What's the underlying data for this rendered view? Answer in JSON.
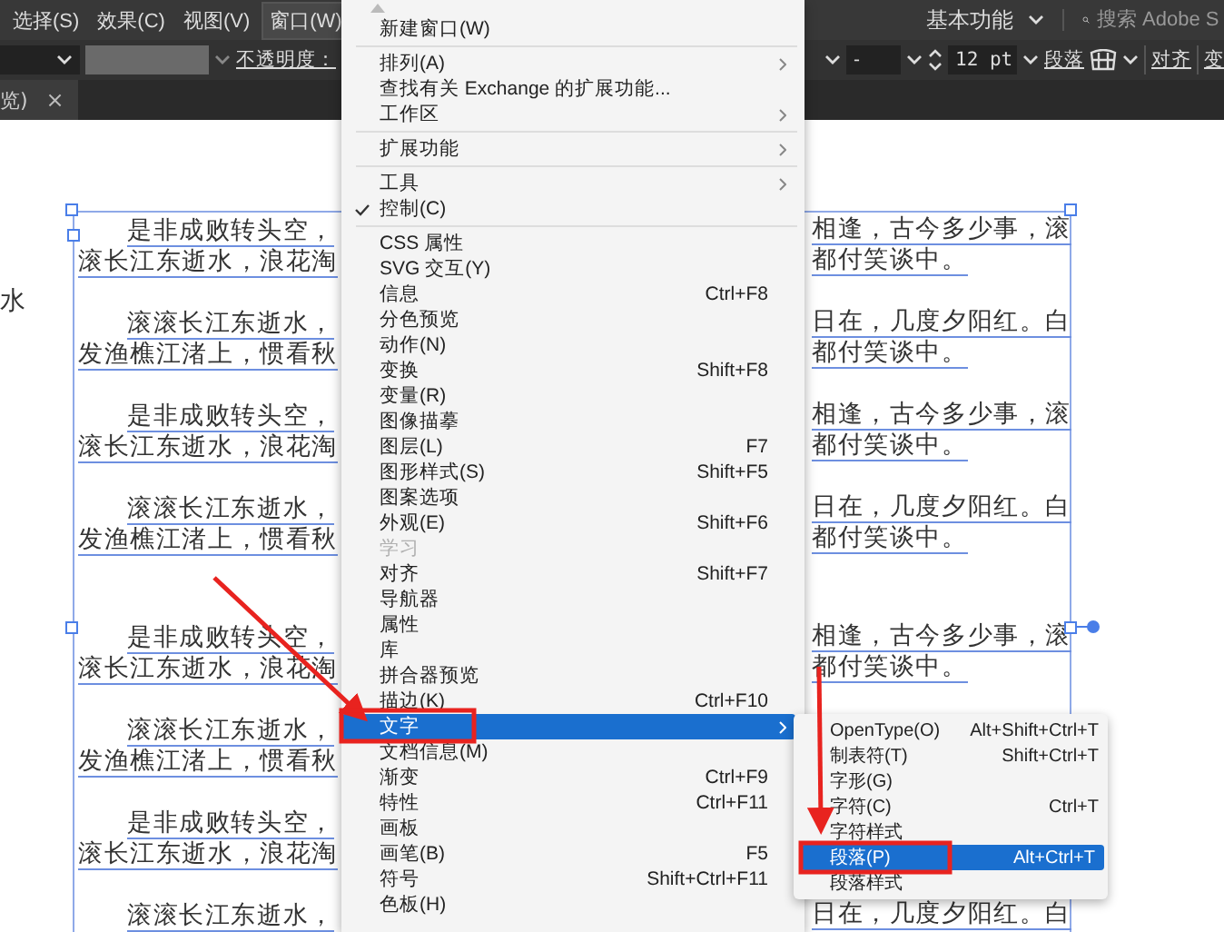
{
  "menubar": {
    "items": [
      {
        "label": "选择(S)",
        "selected": false
      },
      {
        "label": "效果(C)",
        "selected": false
      },
      {
        "label": "视图(V)",
        "selected": false
      },
      {
        "label": "窗口(W)",
        "selected": true
      }
    ],
    "workspace": "基本功能",
    "search_placeholder": "搜索 Adobe S"
  },
  "control_bar": {
    "opacity_label": "不透明度：",
    "field_value": "-",
    "font_size": "12 pt",
    "paragraph_label": "段落",
    "align_label": "对齐",
    "cut_label": "变"
  },
  "tabs": [
    {
      "label": "览)",
      "close": "×",
      "selected": true
    }
  ],
  "document": {
    "stray_text": "水",
    "paragraphs": [
      {
        "kind": "paragraph",
        "lines": [
          {
            "left": "是非成败转头空，",
            "right": "相逢，古今多少事，滚"
          },
          {
            "left": "滚长江东逝水，浪花淘",
            "right": "都付笑谈中。"
          }
        ]
      },
      {
        "kind": "paragraph",
        "lines": [
          {
            "left": "滚滚长江东逝水，",
            "right": "日在，几度夕阳红。白"
          },
          {
            "left": "发渔樵江渚上，惯看秋",
            "right": "都付笑谈中。"
          }
        ]
      },
      {
        "kind": "paragraph",
        "lines": [
          {
            "left": "是非成败转头空，",
            "right": "相逢，古今多少事，滚"
          },
          {
            "left": "滚长江东逝水，浪花淘",
            "right": "都付笑谈中。"
          }
        ]
      },
      {
        "kind": "paragraph",
        "lines": [
          {
            "left": "滚滚长江东逝水，",
            "right": "日在，几度夕阳红。白"
          },
          {
            "left": "发渔樵江渚上，惯看秋",
            "right": "都付笑谈中。"
          }
        ]
      },
      {
        "kind": "blank"
      },
      {
        "kind": "paragraph",
        "lines": [
          {
            "left": "是非成败转头空，",
            "right": "相逢，古今多少事，滚"
          },
          {
            "left": "滚长江东逝水，浪花淘",
            "right": "都付笑谈中。"
          }
        ]
      },
      {
        "kind": "paragraph",
        "lines": [
          {
            "left": "滚滚长江东逝水，"
          },
          {
            "left": "发渔樵江渚上，惯看秋"
          }
        ]
      },
      {
        "kind": "paragraph",
        "lines": [
          {
            "left": "是非成败转头空，"
          },
          {
            "left": "滚长江东逝水，浪花淘"
          }
        ]
      },
      {
        "kind": "paragraph",
        "lines": [
          {
            "left": "滚滚长江东逝水，",
            "right": "日在，几度夕阳红。白"
          }
        ]
      }
    ]
  },
  "window_menu": {
    "items": [
      {
        "kind": "item",
        "label": "新建窗口(W)",
        "submenu": false,
        "checked": false,
        "disabled": false,
        "selected": false
      },
      {
        "kind": "separator"
      },
      {
        "kind": "item",
        "label": "排列(A)",
        "submenu": true,
        "checked": false,
        "disabled": false,
        "selected": false
      },
      {
        "kind": "item",
        "label": "查找有关 Exchange 的扩展功能...",
        "submenu": false,
        "checked": false,
        "disabled": false,
        "selected": false
      },
      {
        "kind": "item",
        "label": "工作区",
        "submenu": true,
        "checked": false,
        "disabled": false,
        "selected": false
      },
      {
        "kind": "separator"
      },
      {
        "kind": "item",
        "label": "扩展功能",
        "submenu": true,
        "checked": false,
        "disabled": false,
        "selected": false
      },
      {
        "kind": "separator"
      },
      {
        "kind": "item",
        "label": "工具",
        "submenu": true,
        "checked": false,
        "disabled": false,
        "selected": false
      },
      {
        "kind": "item",
        "label": "控制(C)",
        "submenu": false,
        "checked": true,
        "disabled": false,
        "selected": false
      },
      {
        "kind": "separator"
      },
      {
        "kind": "item",
        "label": "CSS 属性",
        "submenu": false,
        "checked": false,
        "disabled": false,
        "selected": false
      },
      {
        "kind": "item",
        "label": "SVG 交互(Y)",
        "submenu": false,
        "checked": false,
        "disabled": false,
        "selected": false
      },
      {
        "kind": "item",
        "label": "信息",
        "shortcut": "Ctrl+F8",
        "submenu": false,
        "checked": false,
        "disabled": false,
        "selected": false
      },
      {
        "kind": "item",
        "label": "分色预览",
        "submenu": false,
        "checked": false,
        "disabled": false,
        "selected": false
      },
      {
        "kind": "item",
        "label": "动作(N)",
        "submenu": false,
        "checked": false,
        "disabled": false,
        "selected": false
      },
      {
        "kind": "item",
        "label": "变换",
        "shortcut": "Shift+F8",
        "submenu": false,
        "checked": false,
        "disabled": false,
        "selected": false
      },
      {
        "kind": "item",
        "label": "变量(R)",
        "submenu": false,
        "checked": false,
        "disabled": false,
        "selected": false
      },
      {
        "kind": "item",
        "label": "图像描摹",
        "submenu": false,
        "checked": false,
        "disabled": false,
        "selected": false
      },
      {
        "kind": "item",
        "label": "图层(L)",
        "shortcut": "F7",
        "submenu": false,
        "checked": false,
        "disabled": false,
        "selected": false
      },
      {
        "kind": "item",
        "label": "图形样式(S)",
        "shortcut": "Shift+F5",
        "submenu": false,
        "checked": false,
        "disabled": false,
        "selected": false
      },
      {
        "kind": "item",
        "label": "图案选项",
        "submenu": false,
        "checked": false,
        "disabled": false,
        "selected": false
      },
      {
        "kind": "item",
        "label": "外观(E)",
        "shortcut": "Shift+F6",
        "submenu": false,
        "checked": false,
        "disabled": false,
        "selected": false
      },
      {
        "kind": "item",
        "label": "学习",
        "submenu": false,
        "checked": false,
        "disabled": true,
        "selected": false
      },
      {
        "kind": "item",
        "label": "对齐",
        "shortcut": "Shift+F7",
        "submenu": false,
        "checked": false,
        "disabled": false,
        "selected": false
      },
      {
        "kind": "item",
        "label": "导航器",
        "submenu": false,
        "checked": false,
        "disabled": false,
        "selected": false
      },
      {
        "kind": "item",
        "label": "属性",
        "submenu": false,
        "checked": false,
        "disabled": false,
        "selected": false
      },
      {
        "kind": "item",
        "label": "库",
        "submenu": false,
        "checked": false,
        "disabled": false,
        "selected": false
      },
      {
        "kind": "item",
        "label": "拼合器预览",
        "submenu": false,
        "checked": false,
        "disabled": false,
        "selected": false
      },
      {
        "kind": "item",
        "label": "描边(K)",
        "shortcut": "Ctrl+F10",
        "submenu": false,
        "checked": false,
        "disabled": false,
        "selected": false
      },
      {
        "kind": "item",
        "label": "文字",
        "submenu": true,
        "checked": false,
        "disabled": false,
        "selected": true
      },
      {
        "kind": "item",
        "label": "文档信息(M)",
        "submenu": false,
        "checked": false,
        "disabled": false,
        "selected": false
      },
      {
        "kind": "item",
        "label": "渐变",
        "shortcut": "Ctrl+F9",
        "submenu": false,
        "checked": false,
        "disabled": false,
        "selected": false
      },
      {
        "kind": "item",
        "label": "特性",
        "shortcut": "Ctrl+F11",
        "submenu": false,
        "checked": false,
        "disabled": false,
        "selected": false
      },
      {
        "kind": "item",
        "label": "画板",
        "submenu": false,
        "checked": false,
        "disabled": false,
        "selected": false
      },
      {
        "kind": "item",
        "label": "画笔(B)",
        "shortcut": "F5",
        "submenu": false,
        "checked": false,
        "disabled": false,
        "selected": false
      },
      {
        "kind": "item",
        "label": "符号",
        "shortcut": "Shift+Ctrl+F11",
        "submenu": false,
        "checked": false,
        "disabled": false,
        "selected": false
      },
      {
        "kind": "item",
        "label": "色板(H)",
        "submenu": false,
        "checked": false,
        "disabled": false,
        "selected": false
      }
    ]
  },
  "type_submenu": {
    "items": [
      {
        "label": "OpenType(O)",
        "shortcut": "Alt+Shift+Ctrl+T",
        "selected": false
      },
      {
        "label": "制表符(T)",
        "shortcut": "Shift+Ctrl+T",
        "selected": false
      },
      {
        "label": "字形(G)",
        "selected": false
      },
      {
        "label": "字符(C)",
        "shortcut": "Ctrl+T",
        "selected": false
      },
      {
        "label": "字符样式",
        "selected": false
      },
      {
        "label": "段落(P)",
        "shortcut": "Alt+Ctrl+T",
        "selected": true
      },
      {
        "label": "段落样式",
        "selected": false
      }
    ]
  }
}
